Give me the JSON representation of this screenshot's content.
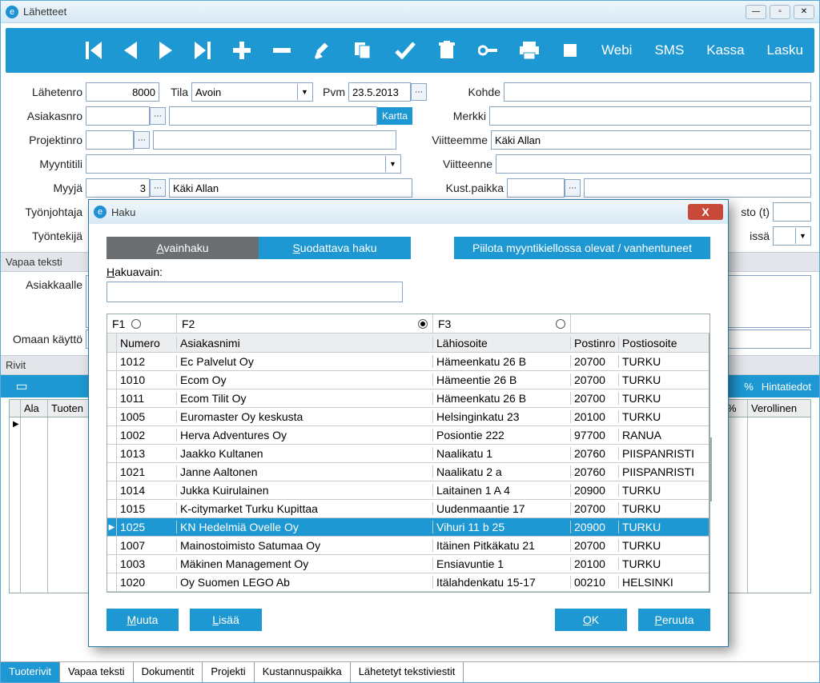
{
  "window": {
    "title": "Lähetteet"
  },
  "toolbar_text": [
    "Webi",
    "SMS",
    "Kassa",
    "Lasku"
  ],
  "form": {
    "labels": {
      "lahetenro": "Lähetenro",
      "tila": "Tila",
      "pvm": "Pvm",
      "kohde": "Kohde",
      "asiakasnro": "Asiakasnro",
      "merkki": "Merkki",
      "projektinro": "Projektinro",
      "viitteemme": "Viitteemme",
      "myyntitili": "Myyntitili",
      "viitteenne": "Viitteenne",
      "myyja": "Myyjä",
      "kustpaikka": "Kust.paikka",
      "tyonjohtaja": "Työnjohtaja",
      "tyontekija": "Työntekijä",
      "sto": "sto (t)",
      "issa": "issä"
    },
    "values": {
      "lahetenro": "8000",
      "tila": "Avoin",
      "pvm": "23.5.2013",
      "myyja_nro": "3",
      "myyja_name": "Käki Allan",
      "viitteemme": "Käki Allan"
    },
    "kartta_btn": "Kartta"
  },
  "sections": {
    "vapaa": "Vapaa teksti",
    "asiakkaalle": "Asiakkaalle",
    "omaan": "Omaan käyttö",
    "rivit": "Rivit"
  },
  "rivit_bar": [
    "%",
    "Hintatiedot"
  ],
  "grid_headers": [
    "Ala",
    "Tuoten",
    "%",
    "Verollinen"
  ],
  "tabs": [
    "Tuoterivit",
    "Vapaa teksti",
    "Dokumentit",
    "Projekti",
    "Kustannuspaikka",
    "Lähetetyt tekstiviestit"
  ],
  "dialog": {
    "title": "Haku",
    "tabs": {
      "avain": "Avainhaku",
      "suod": "Suodattava haku",
      "piilota": "Piilota myyntikiellossa olevat / vanhentuneet"
    },
    "hakuavain": "Hakuavain:",
    "fopts": [
      "F1",
      "F2",
      "F3"
    ],
    "headers": [
      "Numero",
      "Asiakasnimi",
      "Lähiosoite",
      "Postinro",
      "Postiosoite"
    ],
    "rows": [
      {
        "num": "1012",
        "name": "Ec Palvelut Oy",
        "addr": "Hämeenkatu 26 B",
        "post": "20700",
        "city": "TURKU"
      },
      {
        "num": "1010",
        "name": "Ecom Oy",
        "addr": "Hämeentie 26 B",
        "post": "20700",
        "city": "TURKU"
      },
      {
        "num": "1011",
        "name": "Ecom Tilit Oy",
        "addr": "Hämeenkatu 26 B",
        "post": "20700",
        "city": "TURKU"
      },
      {
        "num": "1005",
        "name": "Euromaster Oy keskusta",
        "addr": "Helsinginkatu 23",
        "post": "20100",
        "city": "TURKU"
      },
      {
        "num": "1002",
        "name": "Herva Adventures Oy",
        "addr": "Posiontie 222",
        "post": "97700",
        "city": "RANUA"
      },
      {
        "num": "1013",
        "name": "Jaakko Kultanen",
        "addr": "Naalikatu 1",
        "post": "20760",
        "city": "PIISPANRISTI"
      },
      {
        "num": "1021",
        "name": "Janne Aaltonen",
        "addr": "Naalikatu 2 a",
        "post": "20760",
        "city": "PIISPANRISTI"
      },
      {
        "num": "1014",
        "name": "Jukka Kuirulainen",
        "addr": "Laitainen 1 A 4",
        "post": "20900",
        "city": "TURKU"
      },
      {
        "num": "1015",
        "name": "K-citymarket Turku Kupittaa",
        "addr": "Uudenmaantie 17",
        "post": "20700",
        "city": "TURKU"
      },
      {
        "num": "1025",
        "name": "KN Hedelmiä Ovelle Oy",
        "addr": "Vihuri 11 b 25",
        "post": "20900",
        "city": "TURKU",
        "sel": true
      },
      {
        "num": "1007",
        "name": "Mainostoimisto Satumaa Oy",
        "addr": "Itäinen Pitkäkatu 21",
        "post": "20700",
        "city": "TURKU"
      },
      {
        "num": "1003",
        "name": "Mäkinen Management Oy",
        "addr": "Ensiavuntie 1",
        "post": "20100",
        "city": "TURKU"
      },
      {
        "num": "1020",
        "name": "Oy Suomen LEGO Ab",
        "addr": "Itälahdenkatu 15-17",
        "post": "00210",
        "city": "HELSINKI"
      }
    ],
    "buttons": {
      "muuta": "Muuta",
      "lisaa": "Lisää",
      "ok": "OK",
      "peruuta": "Peruuta"
    }
  }
}
